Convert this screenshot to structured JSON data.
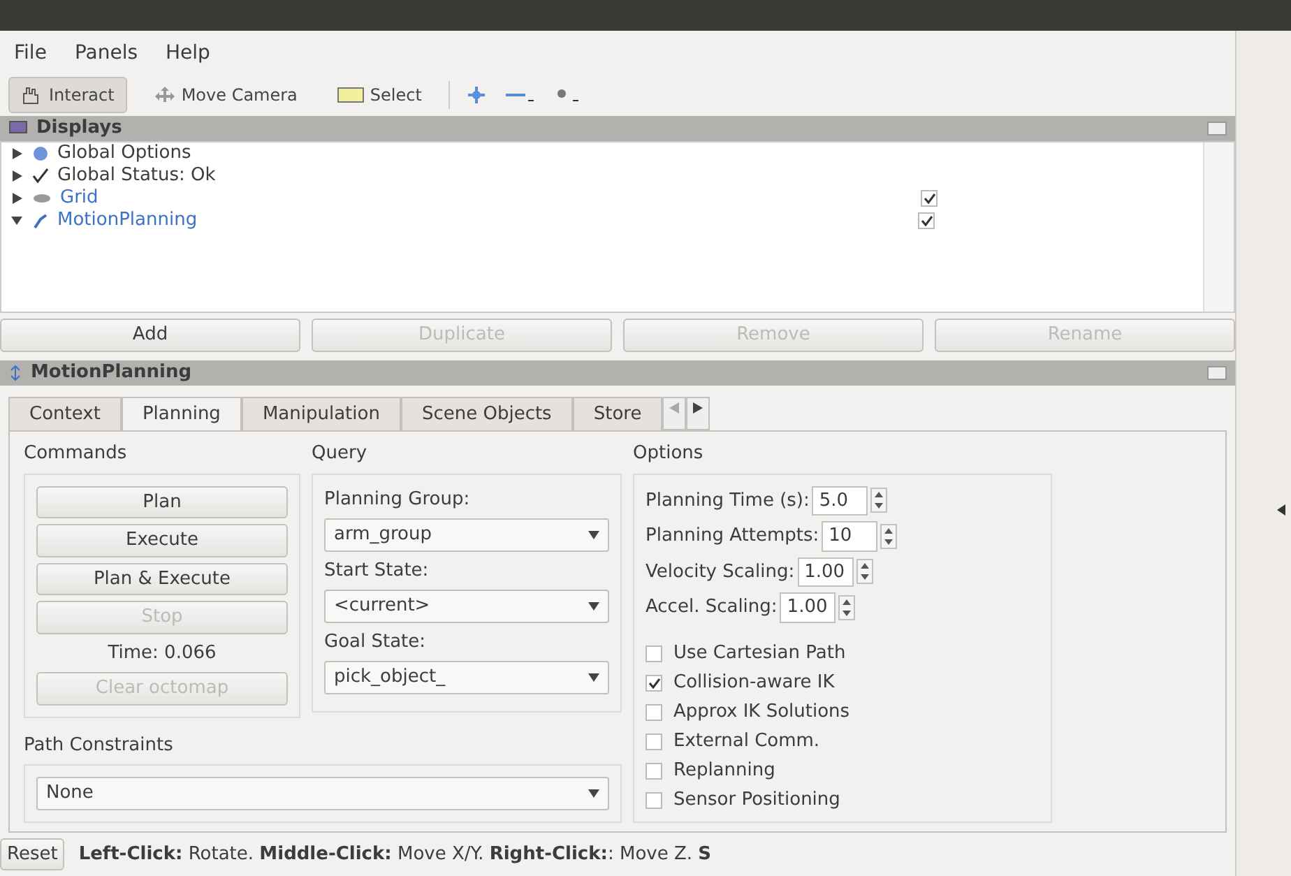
{
  "menu": [
    "File",
    "Panels",
    "Help"
  ],
  "toolbar": [
    {
      "label": "Interact",
      "selected": true,
      "kind": "hand"
    },
    {
      "label": "Move Camera",
      "selected": false,
      "kind": "camera"
    },
    {
      "label": "Select",
      "selected": false,
      "kind": "select"
    }
  ],
  "displays": {
    "title": "Displays",
    "items": [
      {
        "label": "Global Options",
        "kind": "options"
      },
      {
        "label": "Global Status: Ok",
        "kind": "status"
      },
      {
        "label": "Grid",
        "kind": "grid",
        "checked": true
      },
      {
        "label": "MotionPlanning",
        "kind": "planning",
        "checked": true
      }
    ],
    "buttons": [
      {
        "label": "Add",
        "disabled": false
      },
      {
        "label": "Duplicate",
        "disabled": true
      },
      {
        "label": "Remove",
        "disabled": true
      },
      {
        "label": "Rename",
        "disabled": true
      }
    ]
  },
  "motion_planning": {
    "title": "MotionPlanning",
    "tabs": [
      {
        "label": "Context",
        "selected": false
      },
      {
        "label": "Planning",
        "selected": true
      },
      {
        "label": "Manipulation",
        "selected": false
      },
      {
        "label": "Scene Objects",
        "selected": false
      },
      {
        "label": "Store",
        "selected": false
      }
    ],
    "commands": {
      "title": "Commands",
      "buttons": [
        {
          "label": "Plan",
          "disabled": false
        },
        {
          "label": "Execute",
          "disabled": false
        },
        {
          "label": "Plan & Execute",
          "disabled": false
        },
        {
          "label": "Stop",
          "disabled": true
        }
      ],
      "time": "Time: 0.066",
      "clear": {
        "label": "Clear octomap",
        "disabled": true
      }
    },
    "query": {
      "title": "Query",
      "fields": [
        {
          "label": "Planning Group:",
          "value": "arm_group"
        },
        {
          "label": "Start State:",
          "value": "<current>"
        },
        {
          "label": "Goal State:",
          "value": "pick_object_"
        }
      ]
    },
    "path_constraints": {
      "title": "Path Constraints",
      "value": "None"
    },
    "options": {
      "title": "Options",
      "spinners": [
        {
          "label": "Planning Time (s):",
          "value": "5.0"
        },
        {
          "label": "Planning Attempts:",
          "value": "10"
        },
        {
          "label": "Velocity Scaling:",
          "value": "1.00"
        },
        {
          "label": "Accel. Scaling:",
          "value": "1.00"
        }
      ],
      "checkboxes": [
        {
          "label": "Use Cartesian Path",
          "checked": false
        },
        {
          "label": "Collision-aware IK",
          "checked": true
        },
        {
          "label": "Approx IK Solutions",
          "checked": false
        },
        {
          "label": "External Comm.",
          "checked": false
        },
        {
          "label": "Replanning",
          "checked": false
        },
        {
          "label": "Sensor Positioning",
          "checked": false
        }
      ]
    }
  },
  "status_bar": {
    "reset": "Reset",
    "hint": "**Left-Click:** Rotate. **Middle-Click:** Move X/Y. **Right-Click:**: Move Z. **S**"
  }
}
